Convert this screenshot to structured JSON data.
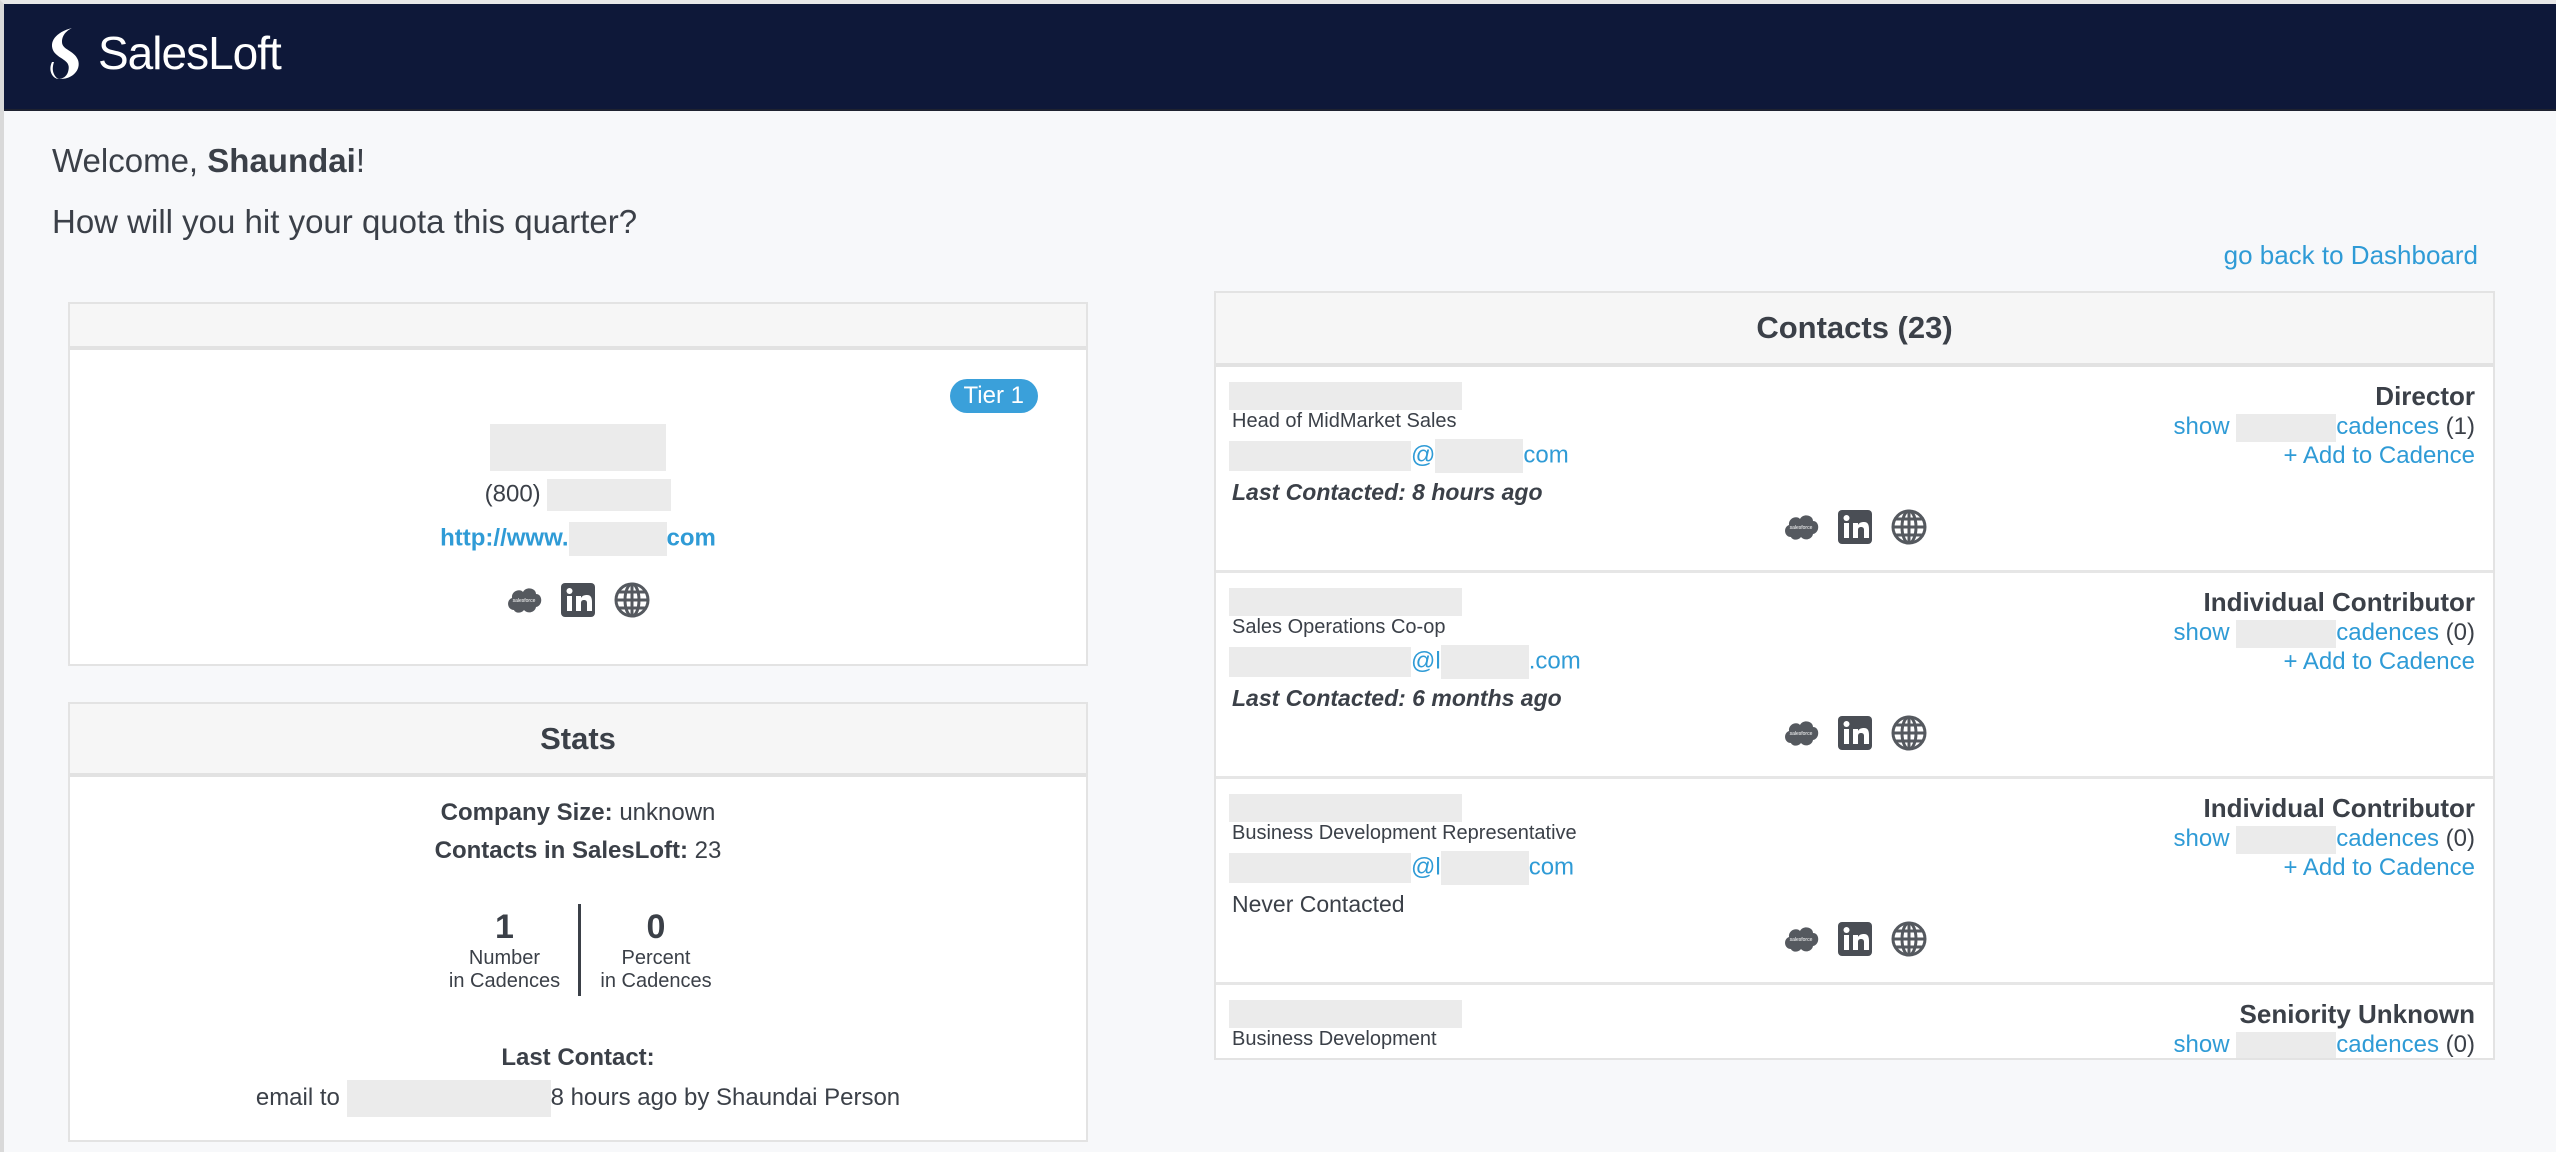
{
  "app": {
    "brand": "SalesLoft"
  },
  "header": {
    "welcome_prefix": "Welcome, ",
    "user_name": "Shaundai",
    "welcome_suffix": "!",
    "subtitle": "How will you hit your quota this quarter?",
    "back_link": "go back to Dashboard"
  },
  "company": {
    "tier": "Tier 1",
    "phone_prefix": "(800)",
    "url_prefix": "http://www.",
    "url_suffix": "com",
    "icons": [
      "salesforce-icon",
      "linkedin-icon",
      "globe-icon"
    ]
  },
  "stats": {
    "title": "Stats",
    "company_size_label": "Company Size:",
    "company_size": "unknown",
    "contacts_label": "Contacts in SalesLoft:",
    "contacts": "23",
    "number_value": "1",
    "number_label1": "Number",
    "number_label2": "in Cadences",
    "percent_value": "0",
    "percent_label1": "Percent",
    "percent_label2": "in Cadences",
    "last_contact_label": "Last Contact:",
    "last_contact_prefix": "email to",
    "last_contact_suffix": "8 hours ago by Shaundai Person"
  },
  "contacts": {
    "title": "Contacts (23)",
    "show": "show",
    "cadences": "cadences",
    "add": "+ Add to Cadence",
    "rows": [
      {
        "title": "Head of MidMarket Sales",
        "email_at": "@",
        "email_suffix": "com",
        "last": "Last Contacted: 8 hours ago",
        "seniority": "Director",
        "count": "(1)"
      },
      {
        "title": "Sales Operations Co-op",
        "email_at": "@l",
        "email_suffix": ".com",
        "last": "Last Contacted: 6 months ago",
        "seniority": "Individual Contributor",
        "count": "(0)"
      },
      {
        "title": "Business Development Representative",
        "email_at": "@l",
        "email_suffix": "com",
        "last": "Never Contacted",
        "seniority": "Individual Contributor",
        "count": "(0)"
      },
      {
        "title": "Business Development",
        "seniority": "Seniority Unknown",
        "count": "(0)"
      }
    ]
  },
  "colors": {
    "nav": "#0e1839",
    "link": "#2f9bd6",
    "badge": "#3aa0da",
    "text": "#3b4048"
  }
}
